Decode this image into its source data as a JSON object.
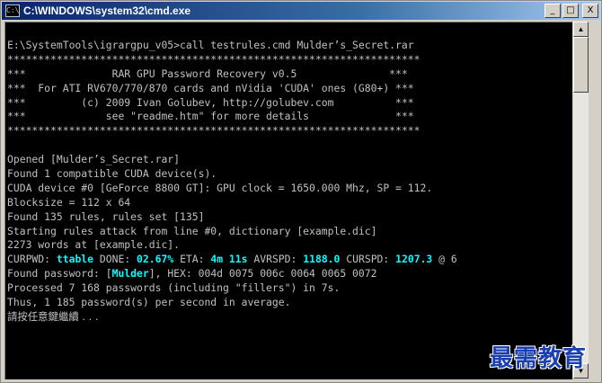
{
  "window": {
    "title": "C:\\WINDOWS\\system32\\cmd.exe",
    "icon": "cmd-icon",
    "controls": {
      "minimize": "_",
      "maximize": "□",
      "close": "X"
    }
  },
  "console": {
    "line1": "E:\\SystemTools\\igrargpu_v05>call testrules.cmd Mulder’s_Secret.rar",
    "line2": "*******************************************************************",
    "line3": "***              RAR GPU Password Recovery v0.5               ***",
    "line4": "***  For ATI RV670/770/870 cards and nVidia 'CUDA' ones (G80+) ***",
    "line5": "***         (c) 2009 Ivan Golubev, http://golubev.com          ***",
    "line6": "***             see \"readme.htm\" for more details              ***",
    "line7": "*******************************************************************",
    "line8": "Opened [Mulder’s_Secret.rar]",
    "line9": "Found 1 compatible CUDA device(s).",
    "line10": "CUDA device #0 [GeForce 8800 GT]: GPU clock = 1650.000 Mhz, SP = 112.",
    "line11": "Blocksize = 112 x 64",
    "line12": "Found 135 rules, rules set [135]",
    "line13": "Starting rules attack from line #0, dictionary [example.dic]",
    "line14": "2273 words at [example.dic].",
    "status": {
      "label": "CURPWD:",
      "curpwd": "ttable",
      "done_label": "DONE:",
      "done": "02.67%",
      "eta_label": "ETA:",
      "eta": "4m 11s",
      "avrspd_label": "AVRSPD:",
      "avrspd": "1188.0",
      "curspd_label": "CURSPD:",
      "curspd": "1207.3",
      "tail": "@ 6"
    },
    "found": {
      "prefix": "Found password: [",
      "password": "Mulder",
      "suffix": "], HEX: 004d 0075 006c 0064 0065 0072"
    },
    "line17": "Processed 7 168 passwords (including \"fillers\") in 7s.",
    "line18": "Thus, 1 185 password(s) per second in average.",
    "line19": "請按任意鍵繼續 . . ."
  },
  "watermark": "最需教育",
  "colors": {
    "console_bg": "#000000",
    "console_text": "#c0c0c0",
    "highlight": "#00ffff",
    "title_bar": "#0a246a"
  }
}
